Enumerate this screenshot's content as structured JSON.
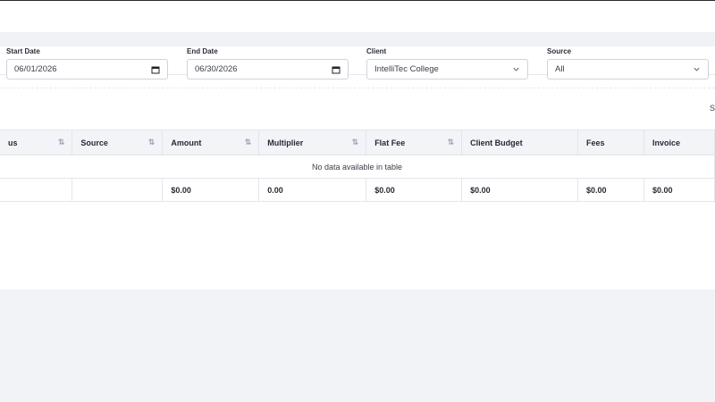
{
  "filters": {
    "start_date": {
      "label": "Start Date",
      "value": "06/01/2026",
      "icon": "calendar-icon"
    },
    "end_date": {
      "label": "End Date",
      "value": "06/30/2026",
      "icon": "calendar-icon"
    },
    "client": {
      "label": "Client",
      "value": "IntelliTec College",
      "icon": "chevron-down-icon"
    },
    "source": {
      "label": "Source",
      "value": "All",
      "icon": "chevron-down-icon"
    }
  },
  "search_peek": "S",
  "table": {
    "columns": [
      {
        "label": "us",
        "sortable": true
      },
      {
        "label": "Source",
        "sortable": true
      },
      {
        "label": "Amount",
        "sortable": true
      },
      {
        "label": "Multiplier",
        "sortable": true
      },
      {
        "label": "Flat Fee",
        "sortable": true
      },
      {
        "label": "Client Budget",
        "sortable": false
      },
      {
        "label": "Fees",
        "sortable": false
      },
      {
        "label": "Invoice",
        "sortable": false
      }
    ],
    "empty_message": "No data available in table",
    "totals": [
      "",
      "",
      "$0.00",
      "0.00",
      "$0.00",
      "$0.00",
      "$0.00",
      "$0.00"
    ]
  }
}
